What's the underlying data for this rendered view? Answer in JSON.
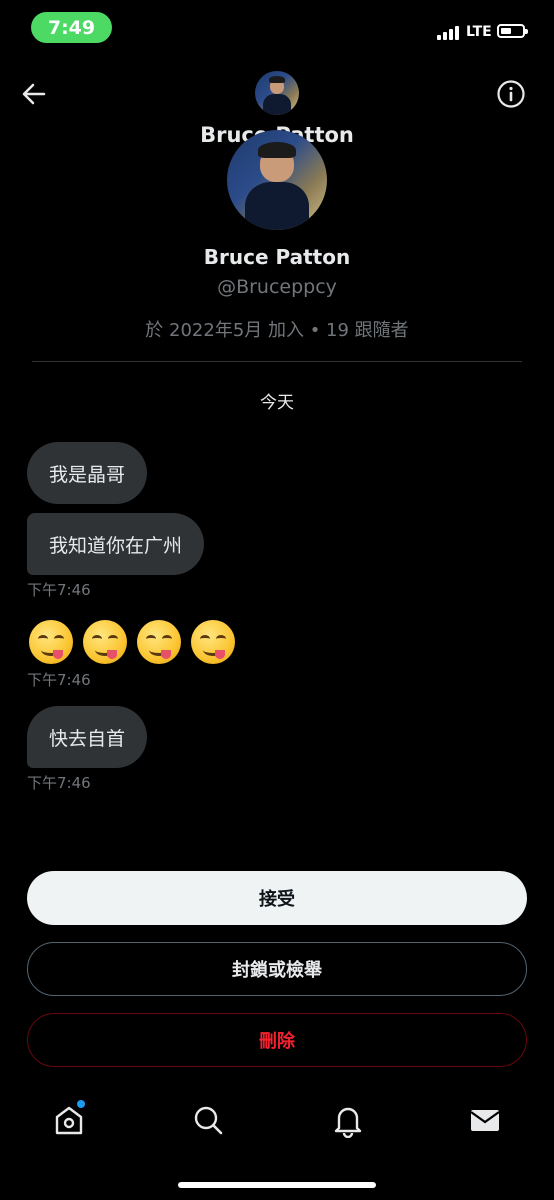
{
  "status_bar": {
    "time": "7:49",
    "network": "LTE",
    "battery_level": 0.4
  },
  "header": {
    "name": "Bruce Patton"
  },
  "profile": {
    "name": "Bruce Patton",
    "handle": "@Bruceppcy",
    "joined_text": "於 2022年5月 加入 • 19 跟隨者"
  },
  "conversation": {
    "date_separator": "今天",
    "messages": [
      {
        "text": "我是晶哥"
      },
      {
        "text": "我知道你在广州",
        "time": "下午7:46"
      },
      {
        "emoji_count": 4,
        "emoji_name": "face-savoring-food-emoji",
        "time": "下午7:46"
      },
      {
        "text": "快去自首",
        "time": "下午7:46"
      }
    ]
  },
  "actions": {
    "accept_label": "接受",
    "block_report_label": "封鎖或檢舉",
    "delete_label": "刪除"
  },
  "tab_bar": {
    "items": [
      "home-icon",
      "search-icon",
      "bell-icon",
      "mail-icon"
    ],
    "home_has_notification": true
  },
  "colors": {
    "background": "#000000",
    "bubble": "#2f3336",
    "accent_blue": "#1d9bf0",
    "danger_red": "#f4212e",
    "secondary_text": "#71767b"
  }
}
